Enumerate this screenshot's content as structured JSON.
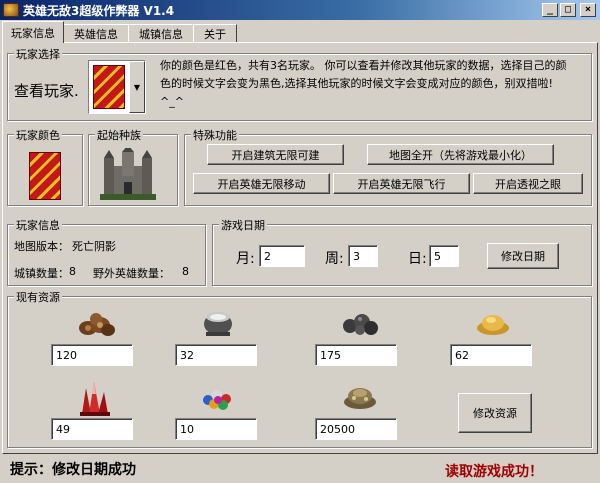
{
  "window": {
    "title": "英雄无敌3超级作弊器 V1.4",
    "min_glyph": "_",
    "max_glyph": "□",
    "close_glyph": "×"
  },
  "tabs": [
    {
      "label": "玩家信息",
      "active": true
    },
    {
      "label": "英雄信息",
      "active": false
    },
    {
      "label": "城镇信息",
      "active": false
    },
    {
      "label": "关于",
      "active": false
    }
  ],
  "player_select": {
    "group_label": "玩家选择",
    "view_label": "查看玩家.",
    "description": "你的颜色是红色，共有3名玩家。    你可以查看并修改其他玩家的数据，选择目己的颜色的时候文字会变为黑色,选择其他玩家的时候文字会变成对应的颜色，别双措啦! ^_^"
  },
  "player_color": {
    "group_label": "玩家颜色"
  },
  "start_race": {
    "group_label": "起始种族"
  },
  "special": {
    "group_label": "特殊功能",
    "buttons": {
      "build_unlimited": "开启建筑无限可建",
      "map_reveal": "地图全开（先将游戏最小化）",
      "hero_move": "开启英雄无限移动",
      "hero_fly": "开启英雄无限飞行",
      "see_through": "开启透视之眼"
    }
  },
  "player_info": {
    "group_label": "玩家信息",
    "map_version_label": "地图版本：",
    "map_version_value": "死亡阴影",
    "towns_label": "城镇数量：",
    "towns_value": "8",
    "wild_heroes_label": "野外英雄数量：",
    "wild_heroes_value": "8"
  },
  "game_date": {
    "group_label": "游戏日期",
    "month_label": "月:",
    "month_value": "2",
    "week_label": "周:",
    "week_value": "3",
    "day_label": "日:",
    "day_value": "5",
    "modify_button": "修改日期"
  },
  "resources": {
    "group_label": "现有资源",
    "items": [
      {
        "icon": "wood-icon",
        "value": "120"
      },
      {
        "icon": "mercury-icon",
        "value": "32"
      },
      {
        "icon": "ore-icon",
        "value": "175"
      },
      {
        "icon": "sulfur-icon",
        "value": "62"
      },
      {
        "icon": "crystal-icon",
        "value": "49"
      },
      {
        "icon": "gems-icon",
        "value": "10"
      },
      {
        "icon": "gold-icon",
        "value": "20500"
      }
    ],
    "modify_button": "修改资源"
  },
  "status": {
    "hint": "提示：修改日期成功",
    "read_status": "读取游戏成功！",
    "read_status_color": "#a00000"
  }
}
